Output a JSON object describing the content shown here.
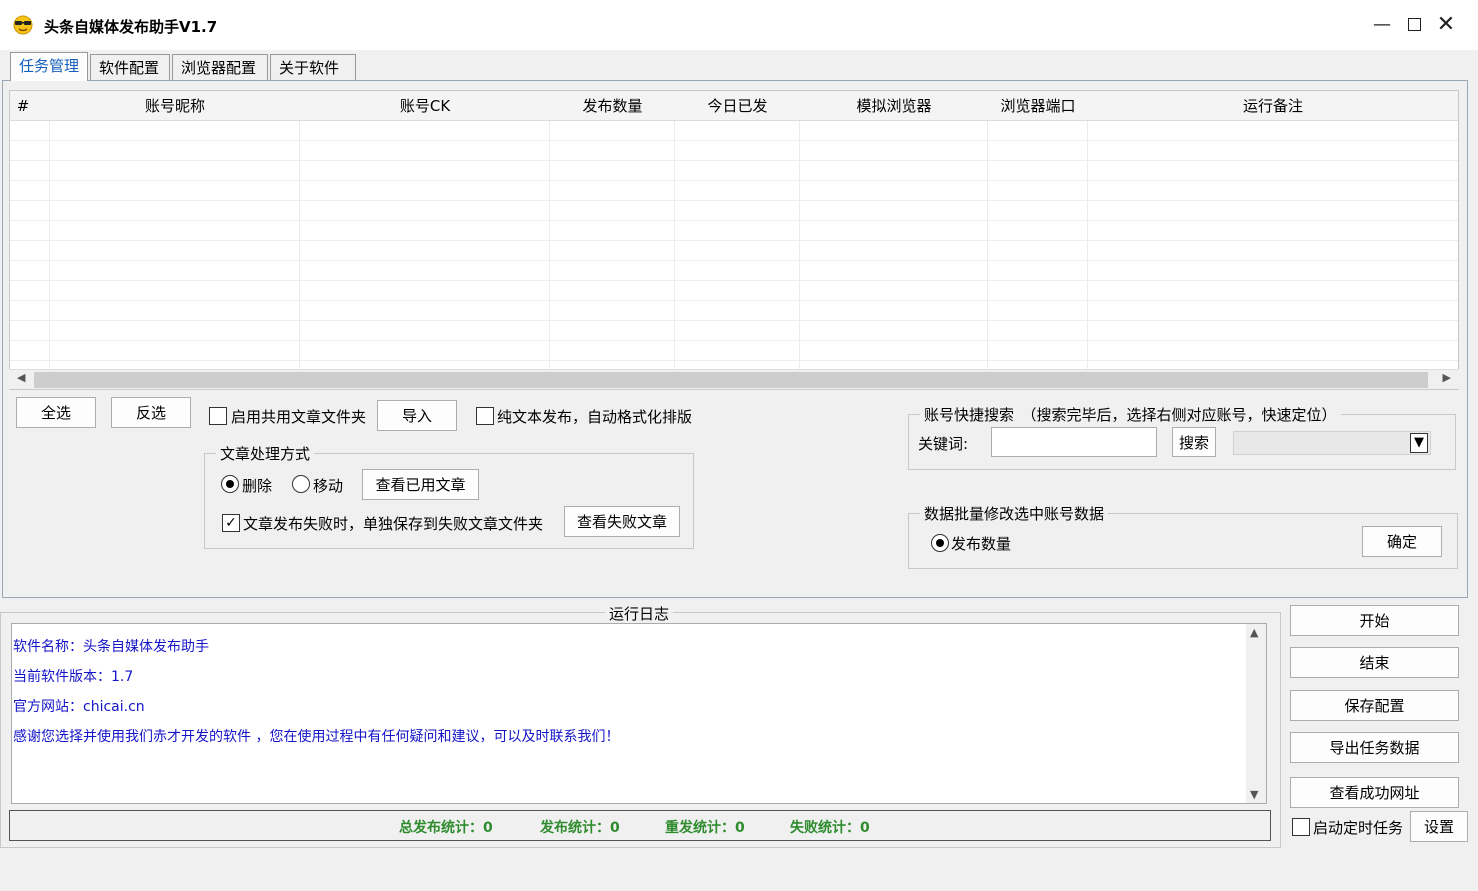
{
  "window": {
    "title": "头条自媒体发布助手V1.7"
  },
  "tabs": [
    "任务管理",
    "软件配置",
    "浏览器配置",
    "关于软件"
  ],
  "grid": {
    "columns": [
      "#",
      "账号昵称",
      "账号CK",
      "发布数量",
      "今日已发",
      "模拟浏览器",
      "浏览器端口",
      "运行备注"
    ]
  },
  "actions": {
    "select_all": "全选",
    "invert": "反选",
    "shared_folder_label": "启用共用文章文件夹",
    "import": "导入",
    "plain_text_label": "纯文本发布，自动格式化排版"
  },
  "article_processing": {
    "title": "文章处理方式",
    "delete_label": "删除",
    "move_label": "移动",
    "view_used": "查看已用文章",
    "save_failed_label": "文章发布失败时，单独保存到失败文章文件夹",
    "view_failed": "查看失败文章"
  },
  "search": {
    "title": "账号快捷搜索　（搜索完毕后，选择右侧对应账号，快速定位）",
    "keyword_label": "关键词:",
    "button": "搜索"
  },
  "batch": {
    "title": "数据批量修改选中账号数据",
    "publish_count_label": "发布数量",
    "confirm": "确定"
  },
  "log": {
    "title": "运行日志",
    "lines": [
      "软件名称：头条自媒体发布助手",
      "当前软件版本：1.7",
      "官方网站：chicai.cn",
      "感谢您选择并使用我们赤才开发的软件 ，您在使用过程中有任何疑问和建议，可以及时联系我们！"
    ]
  },
  "stats": {
    "total": "总发布统计：0",
    "published": "发布统计：0",
    "republished": "重发统计：0",
    "failed": "失败统计：0"
  },
  "side_buttons": {
    "start": "开始",
    "stop": "结束",
    "save_config": "保存配置",
    "export": "导出任务数据",
    "view_success": "查看成功网址",
    "timer_label": "启动定时任务",
    "settings": "设置"
  },
  "icons": {
    "app": "sunglasses-face-icon",
    "minimize": "minimize-icon",
    "maximize": "maximize-icon",
    "close": "close-icon"
  },
  "colors": {
    "active_tab": "#1560bd",
    "log_text": "#1515c8",
    "stats_text": "#2e8b2e"
  }
}
